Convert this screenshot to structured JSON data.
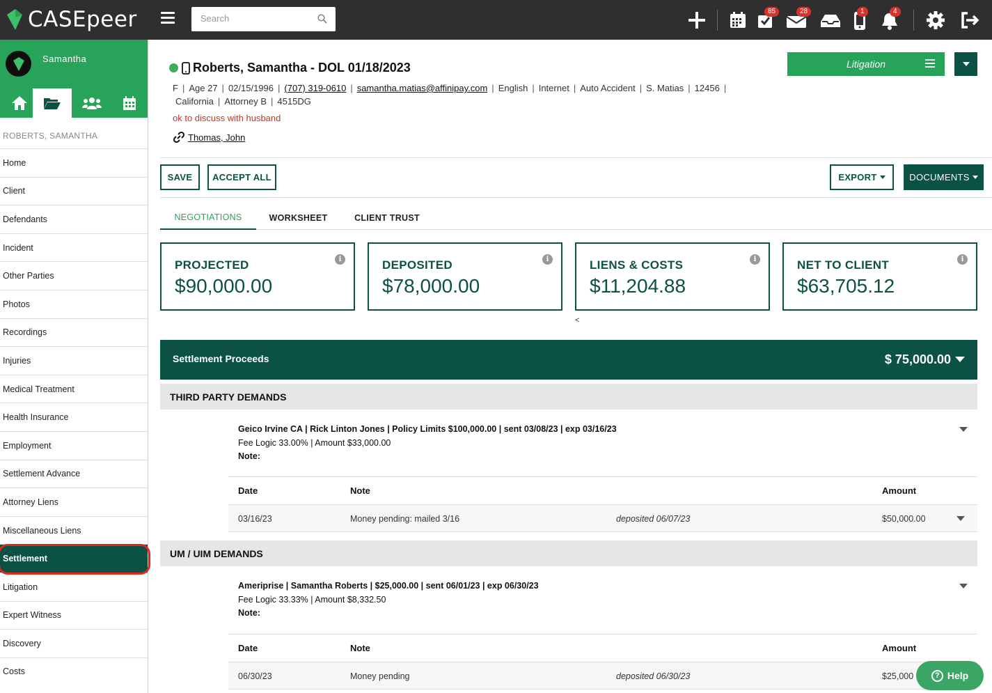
{
  "app": {
    "logo_text": "CASEpeer"
  },
  "search": {
    "placeholder": "Search"
  },
  "top_badges": {
    "tasks": "85",
    "mail": "28",
    "phone": "1",
    "notifications": "4"
  },
  "sidebar": {
    "user": "Samantha",
    "case_name": "ROBERTS, SAMANTHA",
    "items": [
      "Home",
      "Client",
      "Defendants",
      "Incident",
      "Other Parties",
      "Photos",
      "Recordings",
      "Injuries",
      "Medical Treatment",
      "Health Insurance",
      "Employment",
      "Settlement Advance",
      "Attorney Liens",
      "Miscellaneous Liens",
      "Settlement",
      "Litigation",
      "Expert Witness",
      "Discovery",
      "Costs"
    ],
    "active_item": "Settlement"
  },
  "case": {
    "title": "Roberts, Samantha - DOL 01/18/2023",
    "line1": [
      "F",
      "Age 27",
      "02/15/1996",
      "(707) 319-0610",
      "samantha.matias@affinipay.com",
      "English",
      "Internet",
      "Auto Accident",
      "S. Matias",
      "12456"
    ],
    "line2": [
      "California",
      "Attorney B",
      "4515DG"
    ],
    "note": "ok to discuss with husband",
    "linked_contact": "Thomas, John",
    "stage": "Litigation"
  },
  "actions": {
    "save": "SAVE",
    "accept_all": "ACCEPT ALL",
    "export": "EXPORT",
    "documents": "DOCUMENTS"
  },
  "tabs": [
    "NEGOTIATIONS",
    "WORKSHEET",
    "CLIENT TRUST"
  ],
  "summary": [
    {
      "label": "PROJECTED",
      "value": "$90,000.00"
    },
    {
      "label": "DEPOSITED",
      "value": "$78,000.00"
    },
    {
      "label": "LIENS & COSTS",
      "value": "$11,204.88"
    },
    {
      "label": "NET TO CLIENT",
      "value": "$63,705.12"
    }
  ],
  "carousel_prev": "<",
  "proceeds": {
    "label": "Settlement Proceeds",
    "value": "$ 75,000.00"
  },
  "sections": [
    {
      "title": "THIRD PARTY DEMANDS",
      "demand_line": "Geico Irvine CA | Rick Linton Jones | Policy Limits $100,000.00 | sent 03/08/23 | exp 03/16/23",
      "fee_line": "Fee Logic 33.00% | Amount $33,000.00",
      "note_label": "Note:",
      "columns": [
        "Date",
        "Note",
        "Amount"
      ],
      "row": {
        "date": "03/16/23",
        "note": "Money pending: mailed 3/16",
        "status": "deposited 06/07/23",
        "amount": "$50,000.00"
      }
    },
    {
      "title": "UM / UIM DEMANDS",
      "demand_line": "Ameriprise | Samantha Roberts | $25,000.00 | sent 06/01/23 | exp 06/30/23",
      "fee_line": "Fee Logic 33.33% | Amount $8,332.50",
      "note_label": "Note:",
      "columns": [
        "Date",
        "Note",
        "Amount"
      ],
      "row": {
        "date": "06/30/23",
        "note": "Money pending",
        "status": "deposited 06/30/23",
        "amount": "$25,000"
      }
    }
  ],
  "help": {
    "label": "Help",
    "q": "?"
  },
  "colors": {
    "brand_green": "#27a45a",
    "dark_teal": "#0b5144",
    "topbar": "#2f2f2f",
    "badge_red": "#d9322a",
    "highlight_ring": "#e0291b"
  }
}
